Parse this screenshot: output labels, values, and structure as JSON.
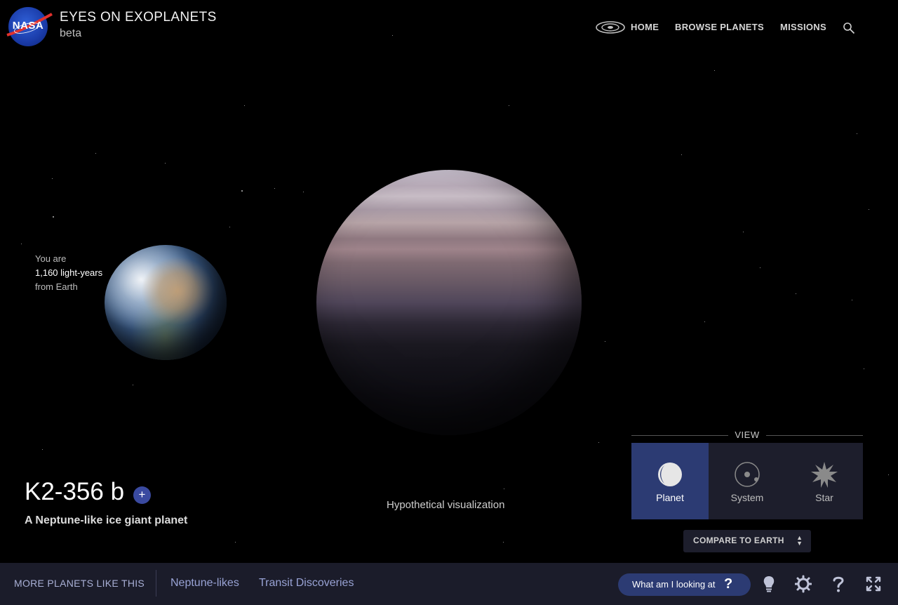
{
  "header": {
    "logo_text": "NASA",
    "title": "EYES ON EXOPLANETS",
    "subtitle": "beta",
    "nav": {
      "home": "HOME",
      "browse": "BROWSE PLANETS",
      "missions": "MISSIONS"
    },
    "icons": [
      "galaxy-icon",
      "search-icon"
    ]
  },
  "distance": {
    "line1": "You are",
    "line2": "1,160 light-years",
    "line3": "from Earth"
  },
  "planet": {
    "name": "K2-356 b",
    "add_label": "+",
    "description": "A Neptune-like ice giant planet",
    "visualization_note": "Hypothetical visualization"
  },
  "view": {
    "label": "VIEW",
    "options": [
      {
        "label": "Planet",
        "icon": "planet-icon",
        "active": true
      },
      {
        "label": "System",
        "icon": "system-icon",
        "active": false
      },
      {
        "label": "Star",
        "icon": "star-icon",
        "active": false
      }
    ],
    "compare_label": "COMPARE TO EARTH"
  },
  "bottom_bar": {
    "more_label": "MORE PLANETS LIKE THIS",
    "links": [
      "Neptune-likes",
      "Transit Discoveries"
    ],
    "what_label": "What am I looking at",
    "what_icon": "?",
    "icons": [
      "lightbulb-icon",
      "settings-gear-icon",
      "help-icon",
      "fullscreen-icon"
    ]
  },
  "colors": {
    "accent": "#2c3b73",
    "panel": "#1d1e2c",
    "bar": "#1b1c2a",
    "link": "#98a2d4"
  }
}
